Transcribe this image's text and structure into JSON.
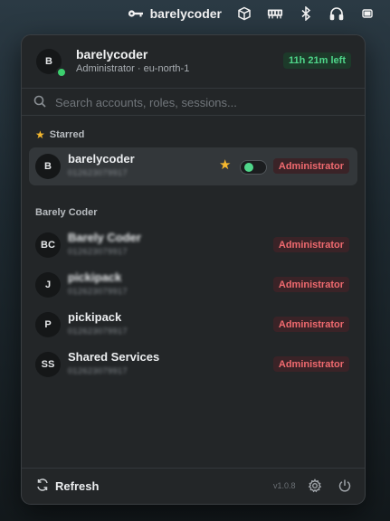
{
  "menubar": {
    "app_label": "barelycoder",
    "icons": [
      "key-icon",
      "cube-icon",
      "memory-icon",
      "bluetooth-icon",
      "headphones-icon",
      "battery-icon"
    ]
  },
  "header": {
    "avatar": "B",
    "name": "barelycoder",
    "subtitle": "Administrator · eu-north-1",
    "session": "11h 21m left"
  },
  "search": {
    "placeholder": "Search accounts, roles, sessions..."
  },
  "starred": {
    "title": "Starred",
    "items": [
      {
        "avatar": "B",
        "name": "barelycoder",
        "account": "012623079917",
        "role": "Administrator"
      }
    ]
  },
  "group": {
    "title": "Barely Coder",
    "items": [
      {
        "avatar": "BC",
        "name": "Barely Coder",
        "account": "012623079917",
        "role": "Administrator"
      },
      {
        "avatar": "J",
        "name": "pickipack",
        "account": "012623079917",
        "role": "Administrator"
      },
      {
        "avatar": "P",
        "name": "pickipack",
        "account": "012623079917",
        "role": "Administrator"
      },
      {
        "avatar": "SS",
        "name": "Shared Services",
        "account": "012623079917",
        "role": "Administrator"
      }
    ]
  },
  "footer": {
    "refresh": "Refresh",
    "version": "v1.0.8"
  },
  "colors": {
    "panel": "#232628",
    "session_green": "#4fd68a",
    "role_red": "#f06a6f",
    "star": "#f5b82e"
  }
}
